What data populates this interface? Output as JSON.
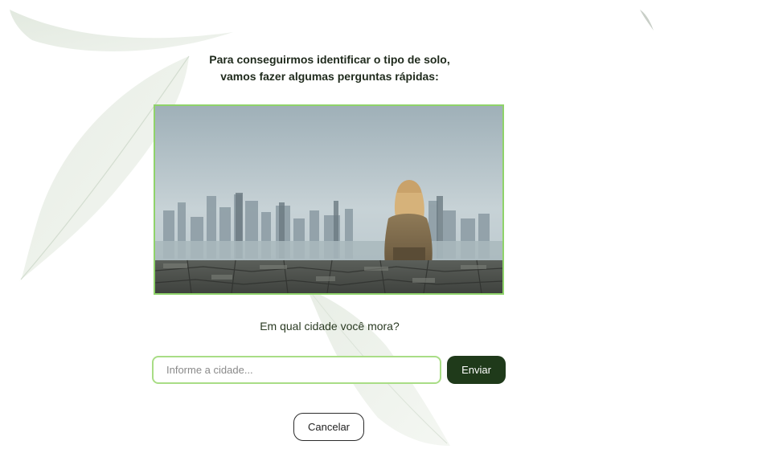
{
  "intro": {
    "line1": "Para conseguirmos identificar o tipo de solo,",
    "line2": "vamos fazer algumas perguntas rápidas:"
  },
  "question": {
    "text": "Em qual cidade você mora?"
  },
  "form": {
    "city_placeholder": "Informe a cidade...",
    "city_value": "",
    "send_label": "Enviar",
    "cancel_label": "Cancelar"
  },
  "colors": {
    "accent_border": "#8fd36a",
    "send_button_bg": "#1f3a1a",
    "text": "#1f2a1c"
  },
  "image": {
    "subject": "woman-sitting-on-stone-wall-overlooking-city"
  }
}
